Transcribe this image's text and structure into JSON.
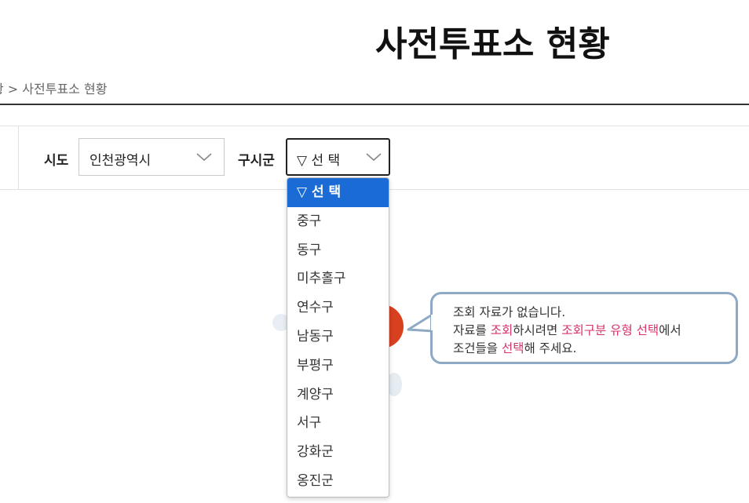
{
  "page": {
    "title": "사전투표소 현황",
    "breadcrumb": "황 > 사전투표소 현황"
  },
  "filters": {
    "sido_label": "시도",
    "sido_value": "인천광역시",
    "sigungu_label": "구시군",
    "sigungu_value": "▽ 선 택"
  },
  "dropdown": {
    "options": [
      "▽ 선 택",
      "중구",
      "동구",
      "미추홀구",
      "연수구",
      "남동구",
      "부평구",
      "계양구",
      "서구",
      "강화군",
      "옹진군"
    ],
    "selected_index": 0
  },
  "message": {
    "line1": "조회 자료가 없습니다.",
    "line2_a": "자료를 ",
    "line2_b": "조회",
    "line2_c": "하시려면 ",
    "line2_d": "조회구분 유형 선택",
    "line2_e": "에서",
    "line3_a": "조건들을 ",
    "line3_b": "선택",
    "line3_c": "해 주세요."
  },
  "colors": {
    "selected_bg": "#1a6bd6",
    "highlight": "#d6336c",
    "bubble_border": "#8ea9c4"
  }
}
